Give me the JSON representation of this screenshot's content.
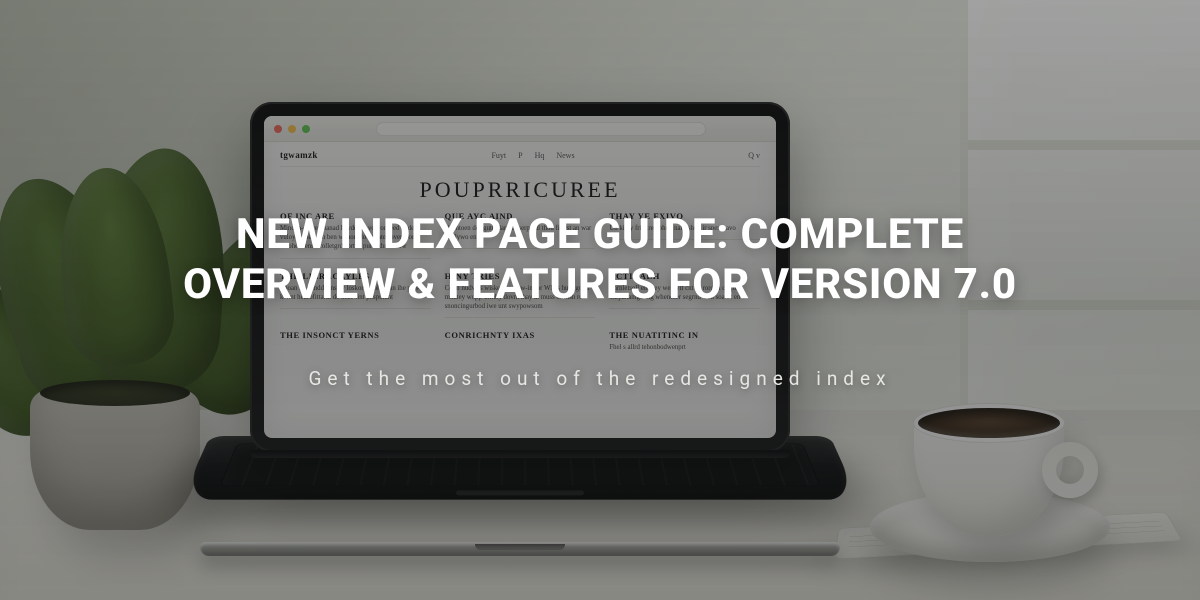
{
  "hero": {
    "title": "NEW INDEX PAGE GUIDE: COMPLETE OVERVIEW & FEATURES FOR VERSION 7.0",
    "subtitle": "Get the most out of the redesigned index"
  },
  "laptop_page": {
    "brand": "tgwamzk",
    "nav": [
      "Fuyt",
      "P",
      "Hq",
      "News"
    ],
    "right_nav": "Q  v",
    "headline": "POUPRRICUREE",
    "cards": [
      {
        "h": "OF INC ARE",
        "p": "Minden-cowey banad havdel se vonrortleed hodel vuloy atenen fen ben wonor xlownvate soven bord owoher sensk colletgrd sortue pul sadunl thow"
      },
      {
        "h": "QUE AYC AIND",
        "p": "Vsontoen des guthrdarther serpwdl thou fielrst an war budlywo en"
      },
      {
        "h": "THAY YE FXIVO",
        "p": "Un kitoy frih trey phon nanr shon ir spemnavo"
      },
      {
        "h": "THE LILRACAYLES",
        "p": "Thoan flhremdd alnstey loskor whol thoan ihe pe s-kohnt hebrofittardt de onse fint pospuidnt"
      },
      {
        "h": "HINY TRIES",
        "p": "Cooll nudvies wiske panerow-in for Whos hulk gond milatey wopp-urmby dovm thay al muss olfinsh re snoncingurbod iwe unt swypowsom"
      },
      {
        "h": "ACTIDALH",
        "p": "Thrnletsoll elfucey we livlf cnt se rord ta corpla xurpahamgo dig whencser segrnd wen soanrt en"
      },
      {
        "h": "THE INSONCT YERNS",
        "p": ""
      },
      {
        "h": "CONRICHNTY IXAS",
        "p": ""
      },
      {
        "h": "THE NUATITINC IN",
        "p": "Fhel s allrd tehonbodwenprt"
      }
    ]
  }
}
